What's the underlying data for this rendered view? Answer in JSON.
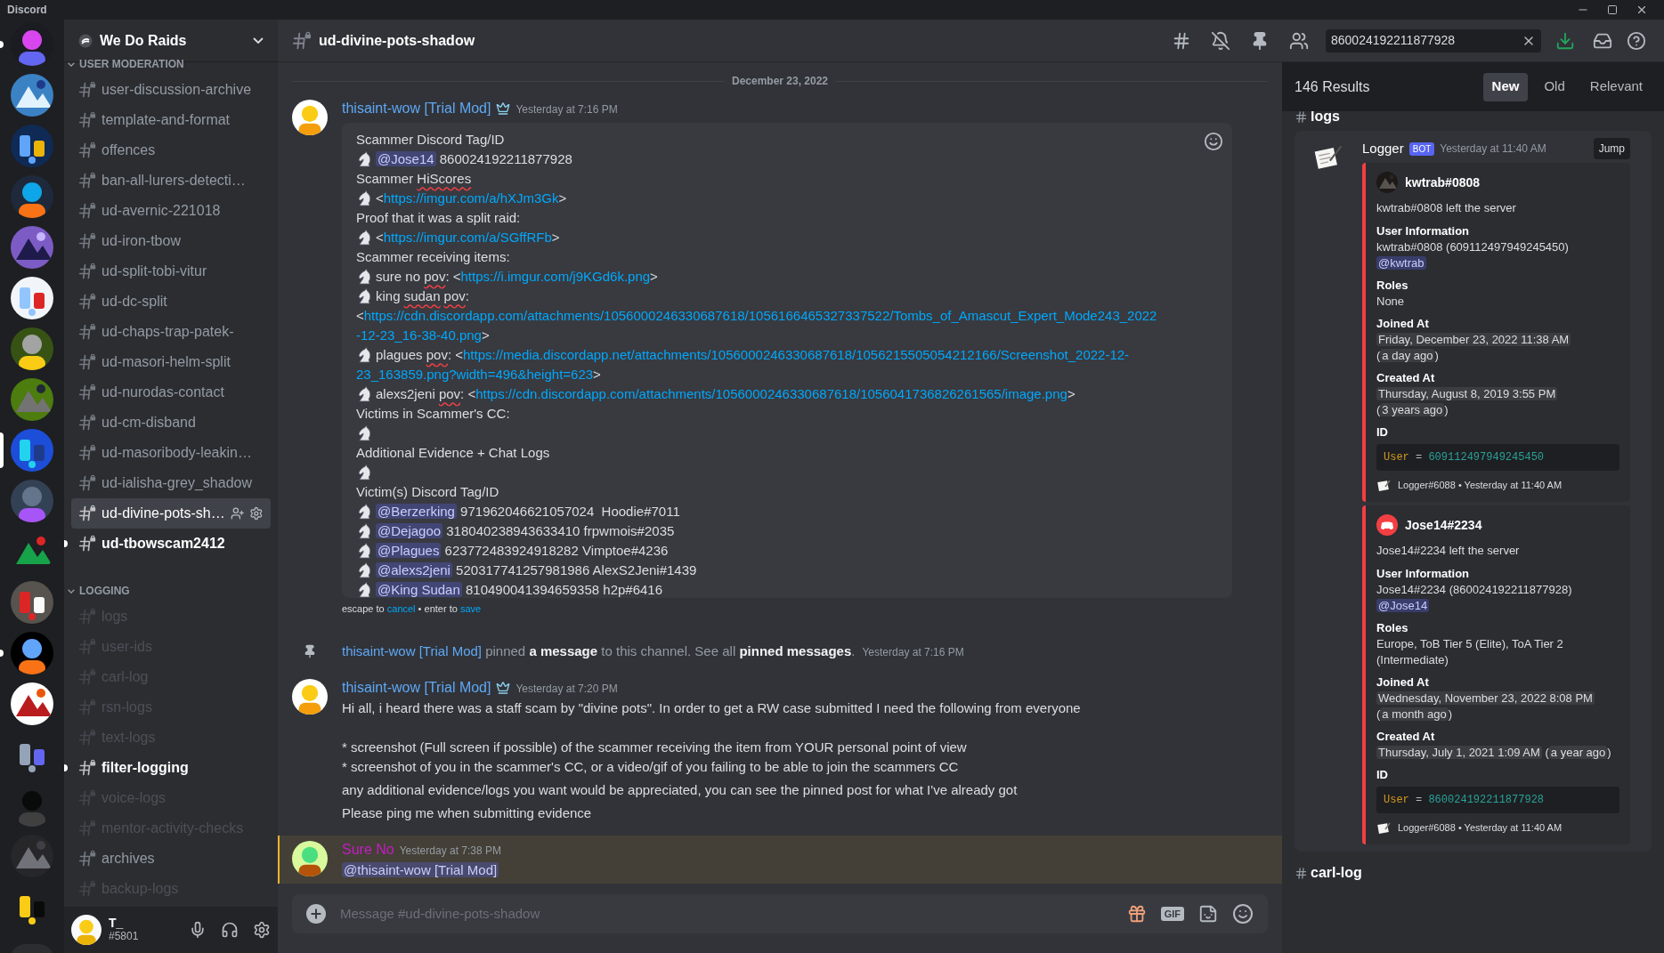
{
  "app_title": "Discord",
  "servers": [
    {
      "unread": true,
      "selected": false
    },
    {
      "unread": false,
      "selected": false
    },
    {
      "unread": false,
      "selected": false
    },
    {
      "unread": false,
      "selected": false
    },
    {
      "unread": false,
      "selected": false
    },
    {
      "unread": false,
      "selected": false
    },
    {
      "unread": false,
      "selected": false
    },
    {
      "unread": false,
      "selected": false
    },
    {
      "unread": false,
      "selected": true
    },
    {
      "unread": false,
      "selected": false
    },
    {
      "unread": false,
      "selected": false
    },
    {
      "unread": false,
      "selected": false
    },
    {
      "unread": true,
      "selected": false
    },
    {
      "unread": false,
      "selected": false
    },
    {
      "unread": false,
      "selected": false
    },
    {
      "unread": false,
      "selected": false
    },
    {
      "unread": false,
      "selected": false
    },
    {
      "unread": false,
      "selected": false
    }
  ],
  "server_name": "We Do Raids",
  "channel_groups": [
    {
      "name": "USER MODERATION",
      "channels": [
        {
          "name": "user-discussion-archive",
          "muted": false,
          "unread": false,
          "selected": false
        },
        {
          "name": "template-and-format",
          "muted": false,
          "unread": false,
          "selected": false
        },
        {
          "name": "offences",
          "muted": false,
          "unread": false,
          "selected": false
        },
        {
          "name": "ban-all-lurers-detecti…",
          "muted": false,
          "unread": false,
          "selected": false
        },
        {
          "name": "ud-avernic-221018",
          "muted": false,
          "unread": false,
          "selected": false
        },
        {
          "name": "ud-iron-tbow",
          "muted": false,
          "unread": false,
          "selected": false
        },
        {
          "name": "ud-split-tobi-vitur",
          "muted": false,
          "unread": false,
          "selected": false
        },
        {
          "name": "ud-dc-split",
          "muted": false,
          "unread": false,
          "selected": false
        },
        {
          "name": "ud-chaps-trap-patek-",
          "muted": false,
          "unread": false,
          "selected": false
        },
        {
          "name": "ud-masori-helm-split",
          "muted": false,
          "unread": false,
          "selected": false
        },
        {
          "name": "ud-nurodas-contact",
          "muted": false,
          "unread": false,
          "selected": false
        },
        {
          "name": "ud-cm-disband",
          "muted": false,
          "unread": false,
          "selected": false
        },
        {
          "name": "ud-masoribody-leakin…",
          "muted": false,
          "unread": false,
          "selected": false
        },
        {
          "name": "ud-ialisha-grey_shadow",
          "muted": false,
          "unread": false,
          "selected": false
        },
        {
          "name": "ud-divine-pots-sh…",
          "muted": false,
          "unread": false,
          "selected": true
        },
        {
          "name": "ud-tbowscam2412",
          "muted": false,
          "unread": true,
          "selected": false
        }
      ]
    },
    {
      "name": "LOGGING",
      "channels": [
        {
          "name": "logs",
          "muted": true,
          "unread": false,
          "selected": false
        },
        {
          "name": "user-ids",
          "muted": true,
          "unread": false,
          "selected": false
        },
        {
          "name": "carl-log",
          "muted": true,
          "unread": false,
          "selected": false
        },
        {
          "name": "rsn-logs",
          "muted": true,
          "unread": false,
          "selected": false
        },
        {
          "name": "text-logs",
          "muted": true,
          "unread": false,
          "selected": false
        },
        {
          "name": "filter-logging",
          "muted": false,
          "unread": true,
          "selected": false
        },
        {
          "name": "voice-logs",
          "muted": true,
          "unread": false,
          "selected": false
        },
        {
          "name": "mentor-activity-checks",
          "muted": true,
          "unread": false,
          "selected": false
        },
        {
          "name": "archives",
          "muted": false,
          "unread": false,
          "selected": false
        },
        {
          "name": "backup-logs",
          "muted": true,
          "unread": false,
          "selected": false
        }
      ]
    }
  ],
  "user": {
    "name": "T_",
    "tag": "#5801"
  },
  "channel_title": "ud-divine-pots-shadow",
  "search": {
    "value": "860024192211877928"
  },
  "date_divider": "December 23, 2022",
  "messages": [
    {
      "kind": "edit",
      "author": "thisaint-wow [Trial Mod]",
      "color": "#5fa8f5",
      "time": "Yesterday at 7:16 PM",
      "mentioned": false,
      "lines": [
        {
          "icon": false,
          "parts": [
            {
              "kind": "text",
              "text": "Scammer Discord Tag/ID"
            }
          ]
        },
        {
          "icon": true,
          "parts": [
            {
              "kind": "mention",
              "text": "@Jose14"
            },
            {
              "kind": "text",
              "text": " 860024192211877928"
            }
          ]
        },
        {
          "icon": false,
          "parts": [
            {
              "kind": "text",
              "text": "Scammer "
            },
            {
              "kind": "misspelled",
              "text": "HiScores"
            }
          ]
        },
        {
          "icon": true,
          "parts": [
            {
              "kind": "text",
              "text": "<"
            },
            {
              "kind": "link",
              "text": "https://imgur.com/a/hXJm3Gk"
            },
            {
              "kind": "text",
              "text": ">"
            }
          ]
        },
        {
          "icon": false,
          "parts": [
            {
              "kind": "text",
              "text": "Proof that it was a split raid:"
            }
          ]
        },
        {
          "icon": true,
          "parts": [
            {
              "kind": "text",
              "text": "<"
            },
            {
              "kind": "link",
              "text": "https://imgur.com/a/SGffRFb"
            },
            {
              "kind": "text",
              "text": ">"
            }
          ]
        },
        {
          "icon": false,
          "parts": [
            {
              "kind": "text",
              "text": "Scammer receiving items:"
            }
          ]
        },
        {
          "icon": true,
          "parts": [
            {
              "kind": "text",
              "text": "sure no "
            },
            {
              "kind": "misspelled",
              "text": "pov"
            },
            {
              "kind": "text",
              "text": ": <"
            },
            {
              "kind": "link",
              "text": "https://i.imgur.com/j9KGd6k.png"
            },
            {
              "kind": "text",
              "text": ">"
            }
          ]
        },
        {
          "icon": true,
          "parts": [
            {
              "kind": "text",
              "text": "king "
            },
            {
              "kind": "misspelled",
              "text": "sudan"
            },
            {
              "kind": "misspelled",
              "text": "pov"
            },
            {
              "kind": "text",
              "text": ":"
            }
          ]
        },
        {
          "icon": false,
          "parts": [
            {
              "kind": "text",
              "text": "<"
            },
            {
              "kind": "link",
              "text": "https://cdn.discordapp.com/attachments/1056000246330687618/1056166465327337522/Tombs_of_Amascut_Expert_Mode243_2022"
            }
          ]
        },
        {
          "icon": false,
          "parts": [
            {
              "kind": "link",
              "text": "-12-23_16-38-40.png"
            },
            {
              "kind": "text",
              "text": ">"
            }
          ]
        },
        {
          "icon": true,
          "parts": [
            {
              "kind": "text",
              "text": "plagues "
            },
            {
              "kind": "misspelled",
              "text": "pov"
            },
            {
              "kind": "text",
              "text": ": <"
            },
            {
              "kind": "link",
              "text": "https://media.discordapp.net/attachments/1056000246330687618/1056215505054212166/Screenshot_2022-12-"
            }
          ]
        },
        {
          "icon": false,
          "parts": [
            {
              "kind": "link",
              "text": "23_163859.png?width=496&height=623"
            },
            {
              "kind": "text",
              "text": ">"
            }
          ]
        },
        {
          "icon": true,
          "parts": [
            {
              "kind": "text",
              "text": "alexs2jeni "
            },
            {
              "kind": "misspelled",
              "text": "pov"
            },
            {
              "kind": "text",
              "text": ": <"
            },
            {
              "kind": "link",
              "text": "https://cdn.discordapp.com/attachments/1056000246330687618/1056041736826261565/image.png"
            },
            {
              "kind": "text",
              "text": ">"
            }
          ]
        },
        {
          "icon": false,
          "parts": [
            {
              "kind": "text",
              "text": "Victims in Scammer's CC:"
            }
          ]
        },
        {
          "icon": true
        },
        {
          "icon": false,
          "parts": [
            {
              "kind": "text",
              "text": "Additional Evidence + Chat Logs"
            }
          ]
        },
        {
          "icon": true
        },
        {
          "icon": false,
          "parts": [
            {
              "kind": "text",
              "text": "Victim(s) Discord Tag/ID"
            }
          ]
        },
        {
          "icon": true,
          "parts": [
            {
              "kind": "mention",
              "text": "@Berzerking"
            },
            {
              "kind": "text",
              "text": " 971962046621057024  Hoodie#7011"
            }
          ]
        },
        {
          "icon": true,
          "parts": [
            {
              "kind": "mention",
              "text": "@Dejagoo"
            },
            {
              "kind": "text",
              "text": " 318040238943633410 frpwmois#2035"
            }
          ]
        },
        {
          "icon": true,
          "parts": [
            {
              "kind": "mention",
              "text": "@Plagues"
            },
            {
              "kind": "text",
              "text": " 623772483924918282 Vimptoe#4236"
            }
          ]
        },
        {
          "icon": true,
          "parts": [
            {
              "kind": "mention",
              "text": "@alexs2jeni"
            },
            {
              "kind": "text",
              "text": " 520317741257981986 AlexS2Jeni#1439"
            }
          ]
        },
        {
          "icon": true,
          "parts": [
            {
              "kind": "mention",
              "text": "@King Sudan"
            },
            {
              "kind": "text",
              "text": " 810490041394659358 h2p#6416"
            }
          ]
        }
      ],
      "hint": [
        {
          "kind": "text",
          "text": "escape to "
        },
        {
          "kind": "link",
          "text": "cancel"
        },
        {
          "kind": "text",
          "text": " • enter to "
        },
        {
          "kind": "link",
          "text": "save"
        }
      ]
    },
    {
      "kind": "system",
      "author": "thisaint-wow [Trial Mod]",
      "color": "#5fa8f5",
      "time": "Yesterday at 7:16 PM",
      "mentioned": false,
      "parts": [
        {
          "kind": "text",
          "text": " pinned "
        },
        {
          "kind": "bold",
          "text": "a message"
        },
        {
          "kind": "text",
          "text": " to this channel. See all "
        },
        {
          "kind": "bold",
          "text": "pinned messages"
        },
        {
          "kind": "text",
          "text": "."
        }
      ]
    },
    {
      "kind": "default",
      "author": "thisaint-wow [Trial Mod]",
      "color": "#5fa8f5",
      "time": "Yesterday at 7:20 PM",
      "mentioned": false,
      "lines": [
        {
          "kind": "text",
          "text": "Hi all, i heard there was a staff scam by \"divine pots\". In order to get a RW case submitted I need the following from everyone"
        },
        {
          "kind": "blank"
        },
        {
          "kind": "text",
          "text": "* screenshot (Full screen if possible) of the scammer receiving the item from YOUR personal point of view"
        },
        {
          "kind": "text",
          "text": "* screenshot of you in the scammer's CC, or a video/gif of you failing to be able to join the scammers CC"
        },
        {
          "kind": "text",
          "text": "any additional evidence/logs you want would be appreciated, you can see the pinned post for what I've already got"
        },
        {
          "kind": "text",
          "text": "Please ping me when submitting evidence"
        }
      ]
    },
    {
      "kind": "reply",
      "author": "Sure No",
      "color": "#c41cc4",
      "time": "Yesterday at 7:38 PM",
      "mentioned": true,
      "mention": "@thisaint-wow [Trial Mod]"
    }
  ],
  "composer": {
    "placeholder": "Message #ud-divine-pots-shadow",
    "gif": "GIF"
  },
  "results": {
    "count": "146 Results",
    "tabs": [
      {
        "label": "New",
        "selected": true
      },
      {
        "label": "Old",
        "selected": false
      },
      {
        "label": "Relevant",
        "selected": false
      }
    ],
    "groups": [
      {
        "channel": "logs",
        "author": "Logger",
        "badge": "BOT",
        "time": "Yesterday at 11:40 AM",
        "jump": "Jump",
        "embeds": [
          {
            "avatar": {
              "kind": "picture"
            },
            "author": "kwtrab#0808",
            "description": "kwtrab#0808 left the server",
            "fields": [
              {
                "name": "User Information",
                "kind": "parts",
                "parts": [
                  {
                    "kind": "text",
                    "text": "kwtrab#0808 (609112497949245450)"
                  },
                  {
                    "kind": "mention",
                    "text": "@kwtrab"
                  }
                ]
              },
              {
                "name": "Roles",
                "kind": "parts",
                "parts": [
                  {
                    "kind": "text",
                    "text": "None"
                  }
                ]
              },
              {
                "name": "Joined At",
                "kind": "parts",
                "parts": [
                  {
                    "kind": "stamp",
                    "text": "Friday, December 23, 2022 11:38 AM"
                  },
                  {
                    "kind": "text",
                    "text": " ("
                  },
                  {
                    "kind": "stamp",
                    "text": "a day ago"
                  },
                  {
                    "kind": "text",
                    "text": ")"
                  }
                ]
              },
              {
                "name": "Created At",
                "kind": "parts",
                "parts": [
                  {
                    "kind": "stamp",
                    "text": "Thursday, August 8, 2019 3:55 PM"
                  },
                  {
                    "kind": "text",
                    "text": " ("
                  },
                  {
                    "kind": "stamp",
                    "text": "3 years ago"
                  },
                  {
                    "kind": "text",
                    "text": ")"
                  }
                ]
              },
              {
                "name": "ID",
                "kind": "code",
                "key": "User",
                "op": "=",
                "value": "609112497949245450"
              }
            ],
            "footer": "Logger#6088 • Yesterday at 11:40 AM"
          },
          {
            "avatar": {
              "kind": "default"
            },
            "author": "Jose14#2234",
            "description": "Jose14#2234 left the server",
            "fields": [
              {
                "name": "User Information",
                "kind": "parts",
                "parts": [
                  {
                    "kind": "text",
                    "text": "Jose14#2234 (860024192211877928)"
                  },
                  {
                    "kind": "mention",
                    "text": "@Jose14"
                  }
                ]
              },
              {
                "name": "Roles",
                "kind": "parts",
                "parts": [
                  {
                    "kind": "text",
                    "text": "Europe, ToB Tier 5 (Elite), ToA Tier 2 (Intermediate)"
                  }
                ]
              },
              {
                "name": "Joined At",
                "kind": "parts",
                "parts": [
                  {
                    "kind": "stamp",
                    "text": "Wednesday, November 23, 2022 8:08 PM"
                  },
                  {
                    "kind": "text",
                    "text": " ("
                  },
                  {
                    "kind": "stamp",
                    "text": "a month ago"
                  },
                  {
                    "kind": "text",
                    "text": ")"
                  }
                ]
              },
              {
                "name": "Created At",
                "kind": "parts",
                "parts": [
                  {
                    "kind": "stamp",
                    "text": "Thursday, July 1, 2021 1:09 AM"
                  },
                  {
                    "kind": "text",
                    "text": " ("
                  },
                  {
                    "kind": "stamp",
                    "text": "a year ago"
                  },
                  {
                    "kind": "text",
                    "text": ")"
                  }
                ]
              },
              {
                "name": "ID",
                "kind": "code",
                "key": "User",
                "op": "=",
                "value": "860024192211877928"
              }
            ],
            "footer": "Logger#6088 • Yesterday at 11:40 AM"
          }
        ]
      },
      {
        "channel": "carl-log"
      }
    ]
  }
}
